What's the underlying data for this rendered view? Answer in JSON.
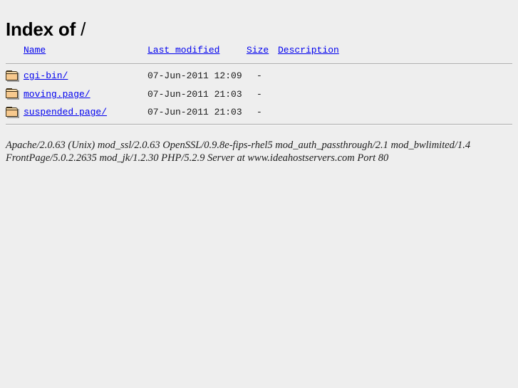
{
  "page": {
    "title_bold": "Index of",
    "title_path": " /",
    "background_color": "#eeeeee",
    "link_color": "#0000ee",
    "text_color": "#000000"
  },
  "table": {
    "headers": {
      "icon": "",
      "name": "Name",
      "last_modified": "Last modified",
      "size": "Size",
      "description": "Description"
    },
    "rows": [
      {
        "icon": "folder-icon",
        "name": "cgi-bin/",
        "last_modified": "07-Jun-2011 12:09",
        "size": "-",
        "description": ""
      },
      {
        "icon": "folder-icon",
        "name": "moving.page/",
        "last_modified": "07-Jun-2011 21:03",
        "size": "-",
        "description": ""
      },
      {
        "icon": "folder-icon",
        "name": "suspended.page/",
        "last_modified": "07-Jun-2011 21:03",
        "size": "-",
        "description": ""
      }
    ]
  },
  "footer": {
    "line1": "Apache/2.0.63 (Unix) mod_ssl/2.0.63 OpenSSL/0.9.8e-fips-rhel5 mod_auth_passthrough/2.1 mod_bwlimited/1.4",
    "line2": "FrontPage/5.0.2.2635 mod_jk/1.2.30 PHP/5.2.9 Server at www.ideahostservers.com Port 80"
  }
}
